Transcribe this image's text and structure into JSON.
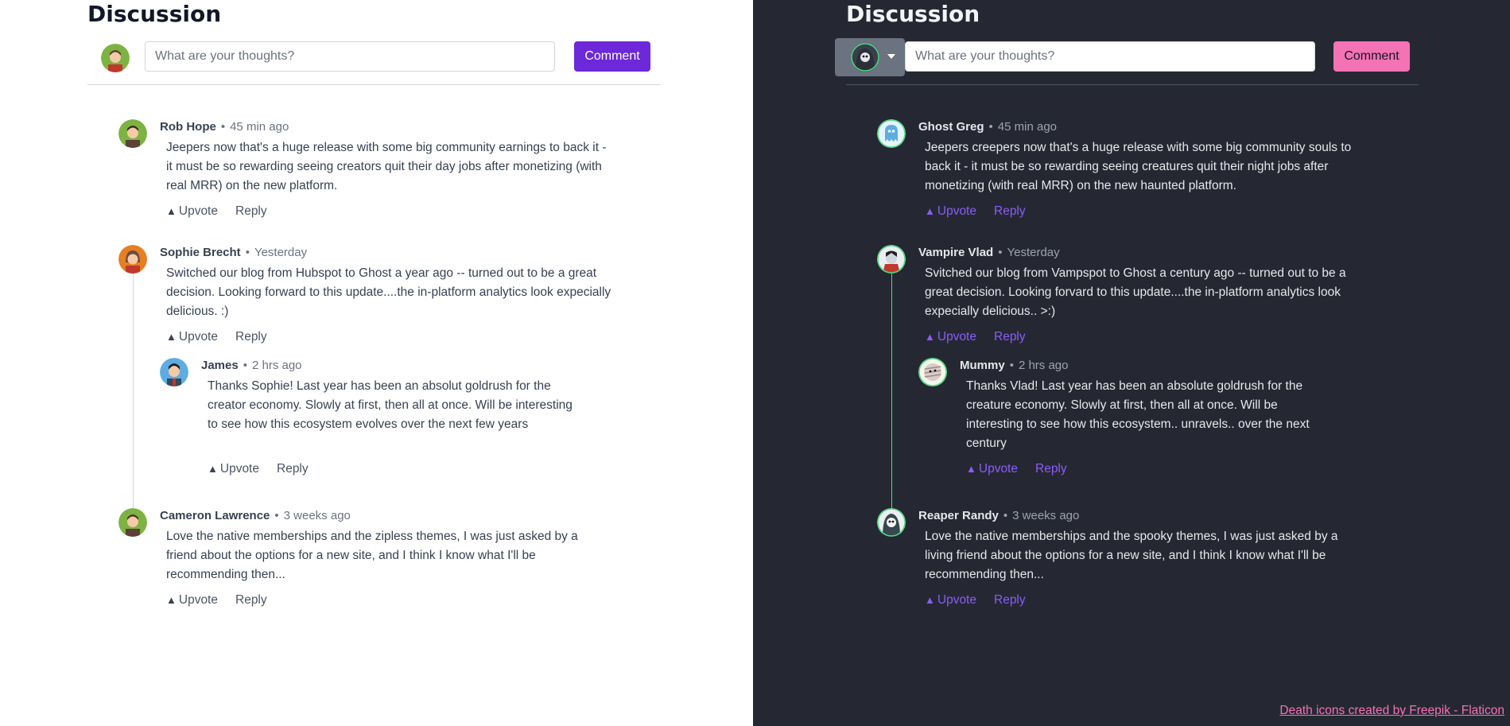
{
  "light": {
    "title": "Discussion",
    "placeholder": "What are your thoughts?",
    "comment_button": "Comment",
    "comments": [
      {
        "author": "Rob Hope",
        "time": "45 min ago",
        "body": "Jeepers now that's a huge release with some big community earnings to back it - it must be so rewarding seeing creators quit their day jobs after monetizing (with real MRR) on the new platform.",
        "upvote": "Upvote",
        "reply": "Reply"
      },
      {
        "author": "Sophie Brecht",
        "time": "Yesterday",
        "body": "Switched our blog from Hubspot to Ghost a year ago -- turned out to be a great decision. Looking forward to this update....the in-platform analytics look expecially delicious. :)",
        "upvote": "Upvote",
        "reply": "Reply"
      },
      {
        "author": "James",
        "time": "2 hrs ago",
        "body": "Thanks Sophie! Last year has been an absolut goldrush for the creator economy. Slowly at first, then all at once. Will be interesting to see how this ecosystem evolves over the next few years",
        "upvote": "Upvote",
        "reply": "Reply"
      },
      {
        "author": "Cameron Lawrence",
        "time": "3 weeks ago",
        "body": "Love the native memberships and the zipless themes, I was just asked by a friend about the options for a new site, and I think I know what I'll be recommending then...",
        "upvote": "Upvote",
        "reply": "Reply"
      }
    ]
  },
  "dark": {
    "title": "Discussion",
    "placeholder": "What are your thoughts?",
    "comment_button": "Comment",
    "comments": [
      {
        "author": "Ghost Greg",
        "time": "45 min ago",
        "body": "Jeepers creepers now that's a huge release with some big community souls to back it - it must be so rewarding seeing creatures quit their night jobs after monetizing (with real MRR) on the new haunted platform.",
        "upvote": "Upvote",
        "reply": "Reply"
      },
      {
        "author": "Vampire Vlad",
        "time": "Yesterday",
        "body": "Svitched our blog from Vampspot to Ghost a century ago -- turned out to be a great decision. Looking forvard to this update....the in-platform analytics look expecially delicious.. >:)",
        "upvote": "Upvote",
        "reply": "Reply"
      },
      {
        "author": "Mummy",
        "time": "2 hrs ago",
        "body": "Thanks Vlad! Last year has been an absolute goldrush for the creature economy. Slowly at first, then all at once. Will be interesting to see how this ecosystem.. unravels.. over the next century",
        "upvote": "Upvote",
        "reply": "Reply"
      },
      {
        "author": "Reaper Randy",
        "time": "3 weeks ago",
        "body": "Love the native memberships and the spooky themes, I was just asked by a living friend about the options for a new site, and I think I know what I'll be recommending then...",
        "upvote": "Upvote",
        "reply": "Reply"
      }
    ],
    "credit": "Death icons created by Freepik - Flaticon"
  },
  "colors": {
    "light_accent": "#6d28d9",
    "dark_bg": "#252833",
    "dark_accent": "#f472b6",
    "dark_link": "#8b5cf6",
    "dark_thread": "#4ade80"
  },
  "icons": {
    "light_me": "user-avatar-icon",
    "dark_me": "grim-reaper-avatar-icon",
    "upvote": "triangle-up-icon",
    "dropdown": "caret-down-icon"
  }
}
